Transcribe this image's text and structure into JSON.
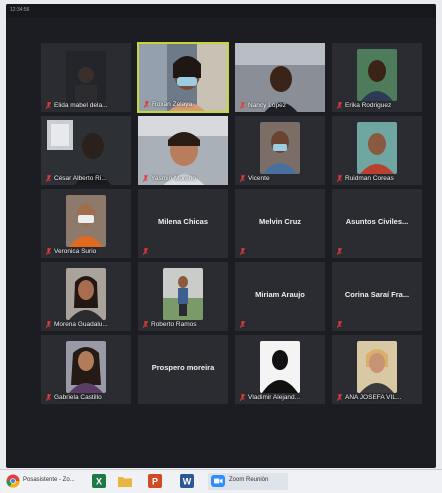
{
  "screen": {
    "top_text": "12:34:56"
  },
  "participants": [
    {
      "name": "Elida mabel dela...",
      "type": "video",
      "active": false
    },
    {
      "name": "Roxan Zelaya",
      "type": "video",
      "active": true
    },
    {
      "name": "Nancy Lopez",
      "type": "video",
      "active": false
    },
    {
      "name": "Erika Rodriguez",
      "type": "video",
      "active": false
    },
    {
      "name": "César Alberto Ri...",
      "type": "video",
      "active": false
    },
    {
      "name": "Yasmin Moreno",
      "type": "video",
      "active": false
    },
    {
      "name": "Vicente",
      "type": "video",
      "active": false
    },
    {
      "name": "Ruidman Coreas",
      "type": "video",
      "active": false
    },
    {
      "name": "Veronica Surio",
      "type": "video",
      "active": false
    },
    {
      "name": "Milena Chicas",
      "type": "name",
      "active": false
    },
    {
      "name": "Melvin Cruz",
      "type": "name",
      "active": false
    },
    {
      "name": "Asuntos Civiles...",
      "type": "name",
      "active": false
    },
    {
      "name": "Morena Guadalu...",
      "type": "video",
      "active": false
    },
    {
      "name": "Roberto Ramos",
      "type": "video",
      "active": false
    },
    {
      "name": "Miriam Araujo",
      "type": "name",
      "active": false
    },
    {
      "name": "Corina Saraí Fra...",
      "type": "name",
      "active": false
    },
    {
      "name": "Gabriela Castillo",
      "type": "video",
      "active": false
    },
    {
      "name": "Prospero moreira",
      "type": "name",
      "active": false
    },
    {
      "name": "Vladimir Alejand...",
      "type": "avatar",
      "active": false
    },
    {
      "name": "ANA JOSEFA VIL...",
      "type": "video",
      "active": false
    }
  ],
  "taskbar": {
    "items": [
      {
        "label": "Posasistente - Zo...",
        "icon": "chrome-icon"
      },
      {
        "label": "",
        "icon": "excel-icon"
      },
      {
        "label": "",
        "icon": "folder-icon"
      },
      {
        "label": "",
        "icon": "powerpoint-icon"
      },
      {
        "label": "",
        "icon": "word-icon"
      },
      {
        "label": "Zoom Reunión",
        "icon": "zoom-icon"
      }
    ]
  },
  "colors": {
    "active_border": "#c7d43a",
    "mic_muted": "#e23a3a",
    "screen_bg": "#1c1d22"
  }
}
